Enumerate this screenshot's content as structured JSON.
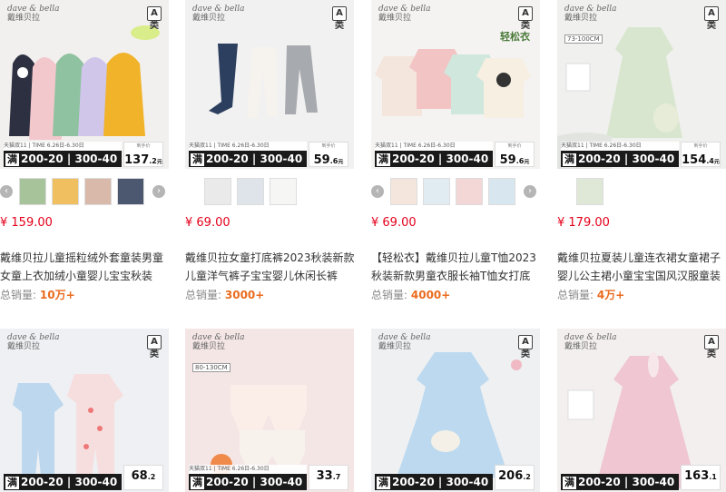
{
  "products": [
    {
      "brand_en": "dave & bella",
      "brand_cn": "戴维贝拉",
      "badge": "A类",
      "promo_top": "天猫双11 | TIME 6.26日-6.30日",
      "promo_man": "满",
      "promo_text": "200-20 | 300-40",
      "price_label": "到手价",
      "price_big": "137",
      "price_small": ".2",
      "price_unit": "元",
      "price": "¥ 159.00",
      "title": "戴维贝拉儿童摇粒绒外套童装男童女童上衣加绒小童婴儿宝宝秋装",
      "sales_label": "总销量:",
      "sales_value": "10万+",
      "bg": "#f2f0ee"
    },
    {
      "brand_en": "dave & bella",
      "brand_cn": "戴维贝拉",
      "badge": "A类",
      "promo_top": "天猫双11 | TIME 6.26日-6.30日",
      "promo_man": "满",
      "promo_text": "200-20 | 300-40",
      "price_label": "到手价",
      "price_big": "59",
      "price_small": ".6",
      "price_unit": "元",
      "price": "¥ 69.00",
      "title": "戴维贝拉女童打底裤2023秋装新款儿童洋气裤子宝宝婴儿休闲长裤",
      "sales_label": "总销量:",
      "sales_value": "3000+",
      "bg": "#f1f1f1"
    },
    {
      "brand_en": "dave & bella",
      "brand_cn": "戴维贝拉",
      "badge": "A类",
      "tag": "轻松衣",
      "promo_top": "天猫双11 | TIME 6.26日-6.30日",
      "promo_man": "满",
      "promo_text": "200-20 | 300-40",
      "price_label": "到手价",
      "price_big": "59",
      "price_small": ".6",
      "price_unit": "元",
      "price": "¥ 69.00",
      "title": "【轻松衣】戴维贝拉儿童T恤2023秋装新款男童衣服长袖T恤女打底",
      "sales_label": "总销量:",
      "sales_value": "4000+",
      "bg": "#f4f3f1"
    },
    {
      "brand_en": "dave & bella",
      "brand_cn": "戴维贝拉",
      "badge": "A类",
      "small_tag": "73-100CM",
      "promo_top": "天猫双11 | TIME 6.26日-6.30日",
      "promo_man": "满",
      "promo_text": "200-20 | 300-40",
      "price_label": "到手价",
      "price_big": "154",
      "price_small": ".4",
      "price_unit": "元",
      "price": "¥ 179.00",
      "title": "戴维贝拉夏装儿童连衣裙女童裙子婴儿公主裙小童宝宝国风汉服童装",
      "sales_label": "总销量:",
      "sales_value": "4万+",
      "bg": "#f0f0ee"
    },
    {
      "brand_en": "dave & bella",
      "brand_cn": "戴维贝拉",
      "badge": "A类",
      "promo_man": "满",
      "promo_text": "200-20 | 300-40",
      "price_big": "68",
      "price_small": ".2",
      "bg": "#eef0f3"
    },
    {
      "brand_en": "dave & bella",
      "brand_cn": "戴维贝拉",
      "small_tag": "80-130CM",
      "promo_top": "天猫双11 | TIME 6.26日-6.30日",
      "promo_man": "满",
      "promo_text": "200-20 | 300-40",
      "price_big": "33",
      "price_small": ".7",
      "bg": "#f5e6e6"
    },
    {
      "brand_en": "dave & bella",
      "brand_cn": "戴维贝拉",
      "badge": "A类",
      "promo_man": "满",
      "promo_text": "200-20 | 300-40",
      "price_big": "206",
      "price_small": ".2",
      "bg": "#eef0f2"
    },
    {
      "brand_en": "dave & bella",
      "brand_cn": "戴维贝拉",
      "badge": "A类",
      "promo_man": "满",
      "promo_text": "200-20 | 300-40",
      "price_big": "163",
      "price_small": ".1",
      "bg": "#f3efee"
    }
  ],
  "colors": {
    "price_red": "#e4001b",
    "sales_orange": "#e96b1f",
    "promo_black": "#1a1a1a"
  },
  "icons": {
    "prev": "chevron-left-icon",
    "next": "chevron-right-icon"
  },
  "arrows": {
    "left": "‹",
    "right": "›"
  }
}
